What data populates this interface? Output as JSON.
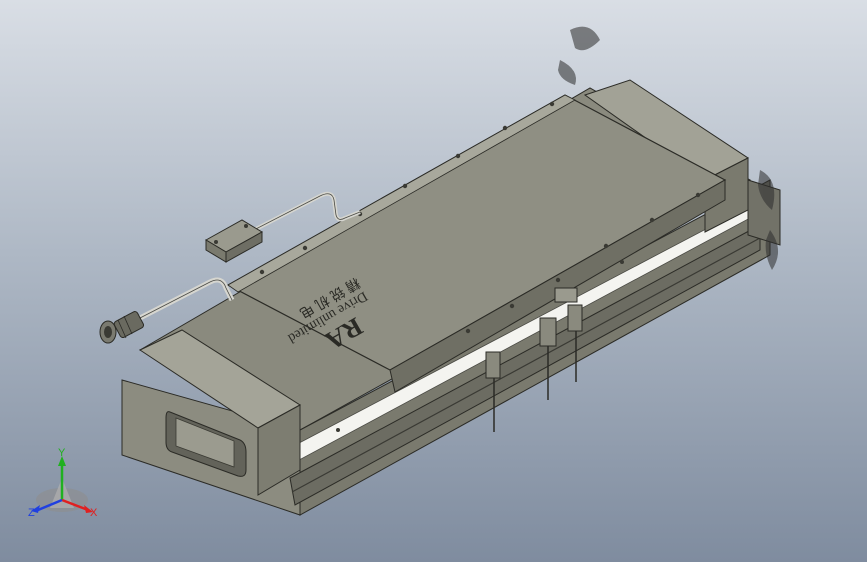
{
  "model": {
    "engraving_lines": [
      "Drive unlimited",
      "精 锐 机 电"
    ],
    "logo_text": "RA"
  },
  "triad": {
    "x_label": "X",
    "y_label": "Y",
    "z_label": "Z",
    "x_color": "#e02020",
    "y_color": "#20b020",
    "z_color": "#2040e0"
  },
  "colors": {
    "body_top": "#9a9a8c",
    "body_side": "#7e7e72",
    "body_dark": "#5e5e55",
    "carriage_top": "#8f8f83",
    "rail": "#f2f2ee",
    "background_top": "#d9dee5",
    "background_bottom": "#7f8c9f"
  }
}
